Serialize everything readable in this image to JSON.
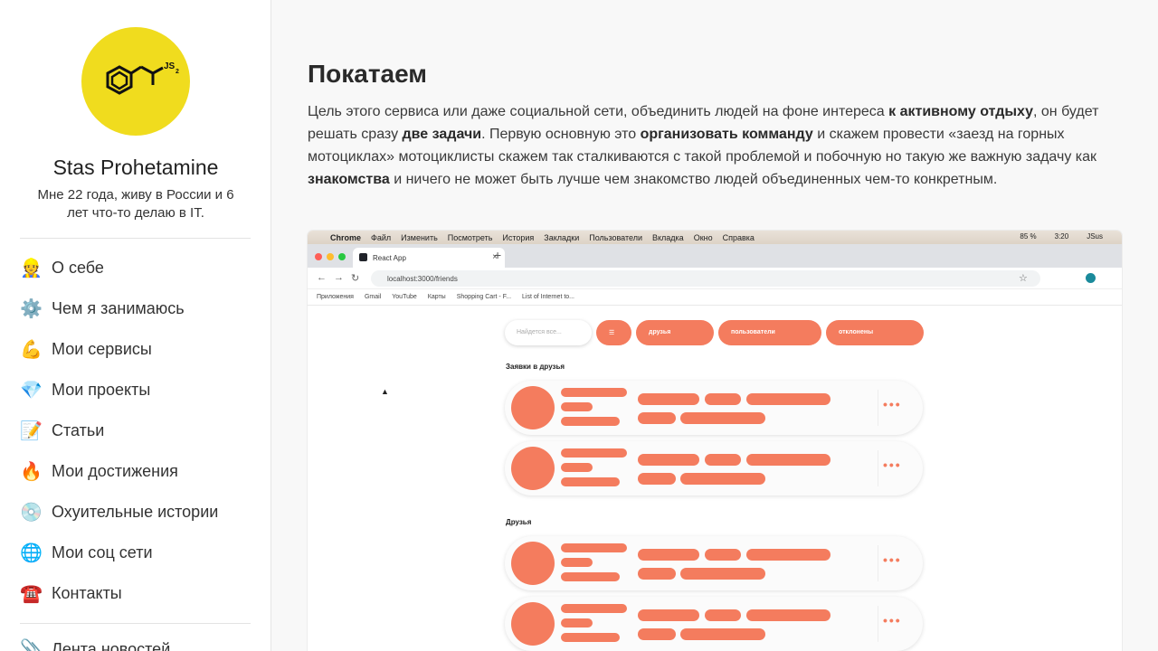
{
  "sidebar": {
    "avatar": {
      "label": "JS",
      "subscript": "2",
      "bg_color": "#f0dc1e"
    },
    "name": "Stas Prohetamine",
    "bio": "Мне 22 года, живу в России и 6 лет что-то делаю в IT.",
    "nav": [
      {
        "emoji": "👷",
        "label": "О себе"
      },
      {
        "emoji": "⚙️",
        "label": "Чем я занимаюсь"
      },
      {
        "emoji": "💪",
        "label": "Мои сервисы"
      },
      {
        "emoji": "💎",
        "label": "Мои проекты"
      },
      {
        "emoji": "📝",
        "label": "Статьи"
      },
      {
        "emoji": "🔥",
        "label": "Мои достижения"
      },
      {
        "emoji": "💿",
        "label": "Охуительные истории"
      },
      {
        "emoji": "🌐",
        "label": "Мои соц сети"
      },
      {
        "emoji": "☎️",
        "label": "Контакты"
      }
    ],
    "extra": {
      "emoji": "📎",
      "label": "Лента новостей"
    }
  },
  "main": {
    "title": "Покатаем",
    "paragraph": [
      {
        "text": "Цель этого сервиса или даже социальной сети, объединить людей на фоне интереса ",
        "bold": false
      },
      {
        "text": "к активному отдыху",
        "bold": true
      },
      {
        "text": ", он будет решать сразу ",
        "bold": false
      },
      {
        "text": "две задачи",
        "bold": true
      },
      {
        "text": ". Первую основную это ",
        "bold": false
      },
      {
        "text": "организовать комманду",
        "bold": true
      },
      {
        "text": " и скажем провести «заезд на горных мотоциклах» мотоциклисты скажем так сталкиваются с такой проблемой и побочную но такую же важную задачу как ",
        "bold": false
      },
      {
        "text": "знакомства",
        "bold": true
      },
      {
        "text": " и ничего не может быть лучше чем знакомство людей объединенных чем-то конкретным.",
        "bold": false
      }
    ]
  },
  "screenshot": {
    "menubar": [
      "",
      "Chrome",
      "Файл",
      "Изменить",
      "Посмотреть",
      "История",
      "Закладки",
      "Пользователи",
      "Вкладка",
      "Окно",
      "Справка"
    ],
    "menubar_right": [
      "85 %",
      "3:20",
      "JSus"
    ],
    "tab_title": "React App",
    "url": "localhost:3000/friends",
    "bookmarks": [
      "Приложения",
      "Gmail",
      "YouTube",
      "Карты",
      "Shopping Cart - F...",
      "List of Internet to..."
    ],
    "search_placeholder": "Найдется все...",
    "pills": [
      "друзья",
      "пользователи",
      "отклонены"
    ],
    "section_requests": "Заявки в друзья",
    "section_friends": "Друзья",
    "accent_color": "#f47c5e"
  }
}
